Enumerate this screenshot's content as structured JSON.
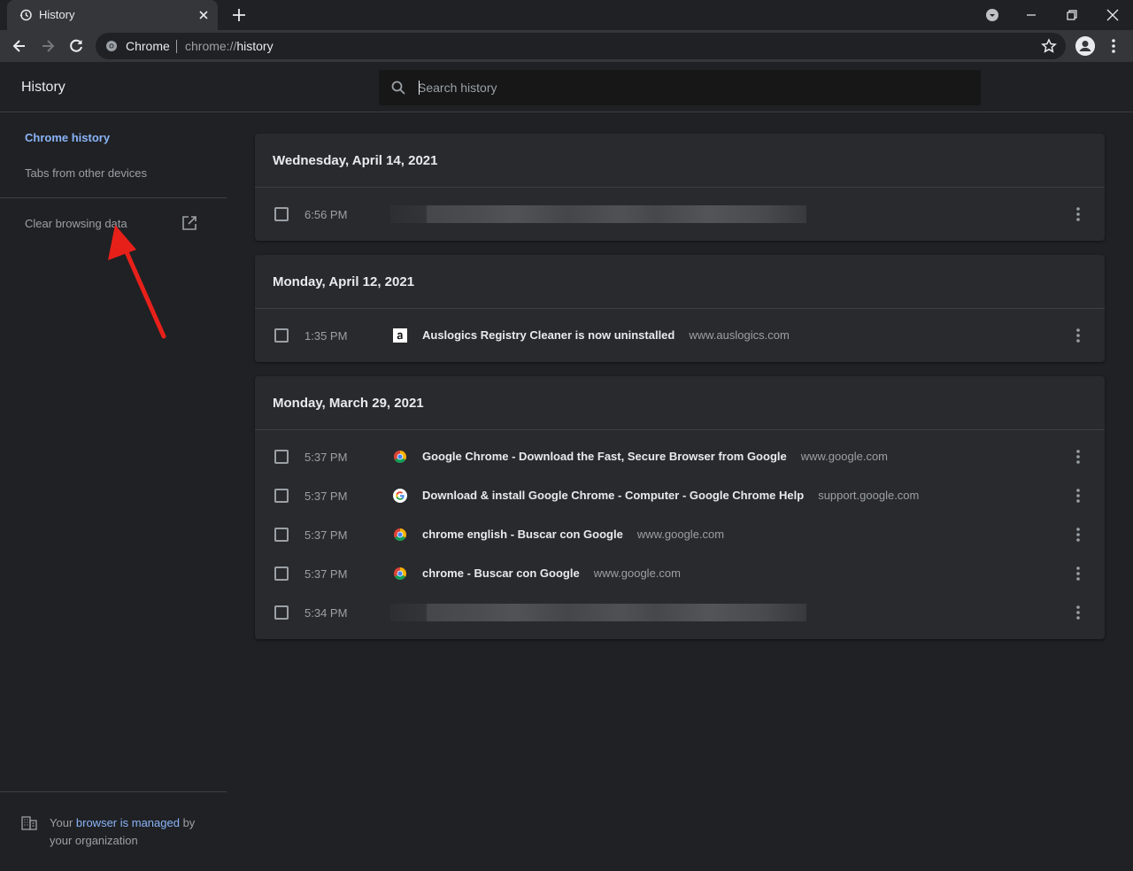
{
  "tab": {
    "title": "History",
    "icon": "history-icon"
  },
  "omnibox": {
    "chip": "Chrome",
    "url_scheme": "chrome://",
    "url_path": "history"
  },
  "header": {
    "title": "History",
    "search_placeholder": "Search history"
  },
  "sidebar": {
    "items": [
      {
        "label": "Chrome history",
        "active": true
      },
      {
        "label": "Tabs from other devices",
        "active": false
      }
    ],
    "clear_label": "Clear browsing data",
    "managed": {
      "prefix": "Your ",
      "link": "browser is managed",
      "suffix": " by your organization"
    }
  },
  "groups": [
    {
      "date": "Wednesday, April 14, 2021",
      "rows": [
        {
          "time": "6:56 PM",
          "title": "",
          "domain": "",
          "favicon": "blurred",
          "blurred": true
        }
      ]
    },
    {
      "date": "Monday, April 12, 2021",
      "rows": [
        {
          "time": "1:35 PM",
          "title": "Auslogics Registry Cleaner is now uninstalled",
          "domain": "www.auslogics.com",
          "favicon": "auslogics-icon",
          "blurred": false
        }
      ]
    },
    {
      "date": "Monday, March 29, 2021",
      "rows": [
        {
          "time": "5:37 PM",
          "title": "Google Chrome - Download the Fast, Secure Browser from Google",
          "domain": "www.google.com",
          "favicon": "chrome-icon",
          "blurred": false
        },
        {
          "time": "5:37 PM",
          "title": "Download & install Google Chrome - Computer - Google Chrome Help",
          "domain": "support.google.com",
          "favicon": "google-g-icon",
          "blurred": false
        },
        {
          "time": "5:37 PM",
          "title": "chrome english - Buscar con Google",
          "domain": "www.google.com",
          "favicon": "chrome-icon",
          "blurred": false
        },
        {
          "time": "5:37 PM",
          "title": "chrome - Buscar con Google",
          "domain": "www.google.com",
          "favicon": "chrome-icon",
          "blurred": false
        },
        {
          "time": "5:34 PM",
          "title": "",
          "domain": "",
          "favicon": "blurred",
          "blurred": true
        }
      ]
    }
  ],
  "colors": {
    "accent": "#8ab4f8",
    "background": "#202124",
    "card": "#292a2d",
    "annotation": "#e8201a"
  }
}
